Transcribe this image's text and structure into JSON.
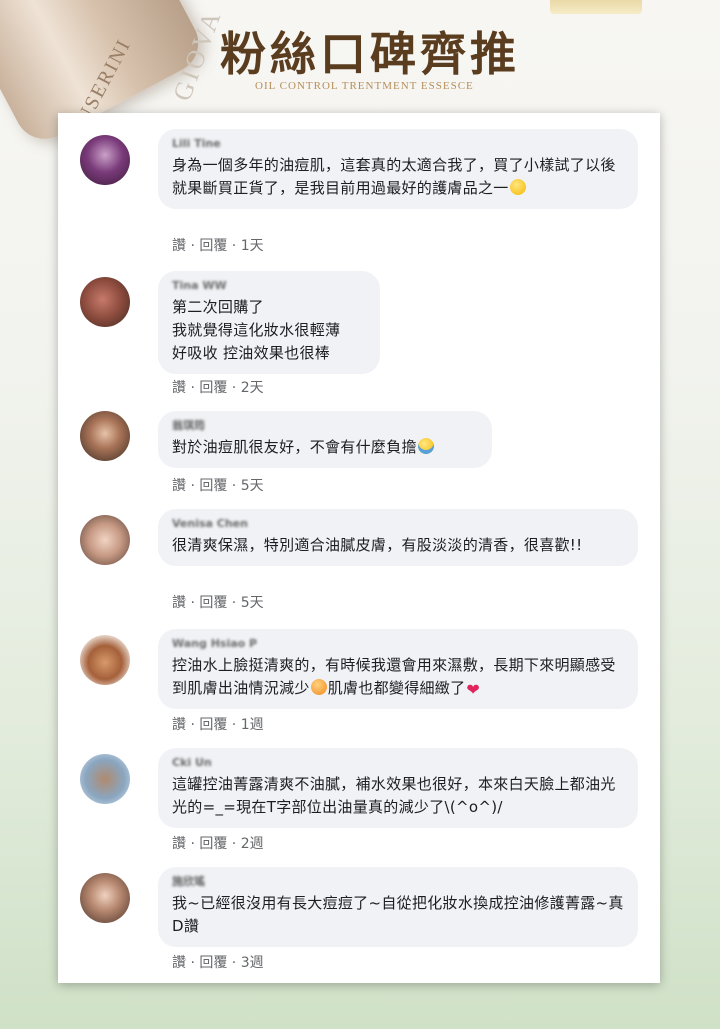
{
  "header": {
    "title": "粉絲口碑齊推",
    "subtitle": "OIL CONTROL TRENTMENT ESSESCE",
    "brand_watermark": "GIOVA",
    "product_label": "USERINI"
  },
  "colors": {
    "title": "#5a3c1f",
    "subtitle": "#b68f5a",
    "bubble": "#f0f2f5",
    "action_text": "#65676b"
  },
  "comments": [
    {
      "name": "Lili Tine",
      "text": "身為一個多年的油痘肌，這套真的太適合我了，買了小樣試了以後就果斷買正貨了，是我目前用過最好的護膚品之一",
      "emoji": "grin-emoji",
      "like": "讚",
      "reply": "回覆",
      "time": "1天"
    },
    {
      "name": "Tina WW",
      "text_lines": [
        "第二次回購了",
        "我就覺得這化妝水很輕薄",
        "好吸收 控油效果也很棒"
      ],
      "like": "讚",
      "reply": "回覆",
      "time": "2天"
    },
    {
      "name": "翁琪筠",
      "text": "對於油痘肌很友好，不會有什麼負擔",
      "emoji": "sunglasses-emoji",
      "like": "讚",
      "reply": "回覆",
      "time": "5天"
    },
    {
      "name": "Venisa Chen",
      "text": "很清爽保濕，特別適合油膩皮膚，有股淡淡的清香，很喜歡!!",
      "like": "讚",
      "reply": "回覆",
      "time": "5天"
    },
    {
      "name": "Wang Hsiao P",
      "text_a": "控油水上臉挺清爽的，有時候我還會用來濕敷，長期下來明顯感受到肌膚出油情況減少",
      "emoji_a": "smiling-hearts-emoji",
      "text_b": "肌膚也都變得細緻了",
      "emoji_b": "heart-emoji",
      "like": "讚",
      "reply": "回覆",
      "time": "1週"
    },
    {
      "name": "Cki Un",
      "text": "這罐控油菁露清爽不油膩，補水效果也很好，本來白天臉上都油光光的=_=現在T字部位出油量真的減少了\\(^o^)/",
      "like": "讚",
      "reply": "回覆",
      "time": "2週"
    },
    {
      "name": "施欣瑤",
      "text": "我~已經很沒用有長大痘痘了~自從把化妝水換成控油修護菁露~真D讚",
      "like": "讚",
      "reply": "回覆",
      "time": "3週"
    }
  ]
}
